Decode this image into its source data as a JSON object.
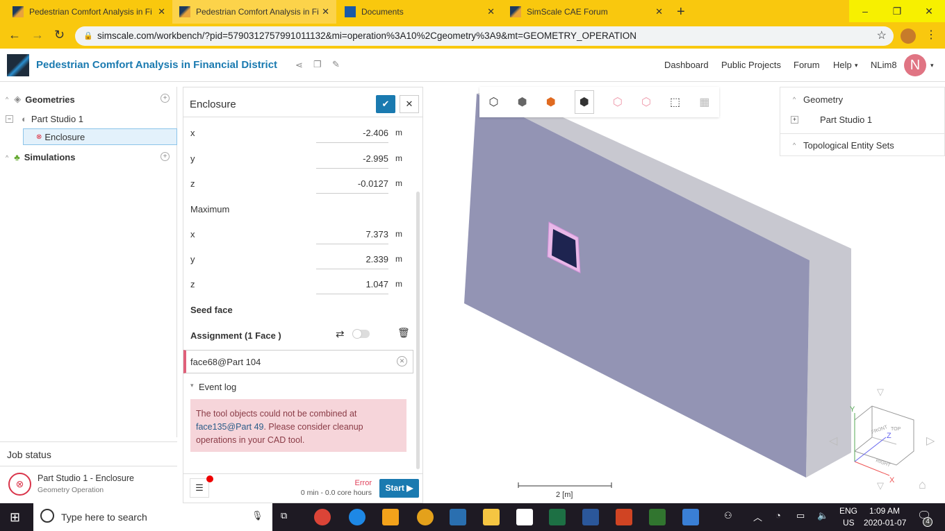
{
  "browser": {
    "tabs": [
      {
        "title": "Pedestrian Comfort Analysis in Fi",
        "active": false
      },
      {
        "title": "Pedestrian Comfort Analysis in Fi",
        "active": true
      },
      {
        "title": "Documents",
        "active": false
      },
      {
        "title": "SimScale CAE Forum",
        "active": false
      }
    ],
    "url": "simscale.com/workbench/?pid=5790312757991011132&mi=operation%3A10%2Cgeometry%3A9&mt=GEOMETRY_OPERATION"
  },
  "header": {
    "title": "Pedestrian Comfort Analysis in Financial District",
    "nav": [
      "Dashboard",
      "Public Projects",
      "Forum",
      "Help"
    ],
    "user": "NLim8",
    "avatar": "N"
  },
  "tree": {
    "geometries": "Geometries",
    "part_studio": "Part Studio 1",
    "enclosure": "Enclosure",
    "simulations": "Simulations"
  },
  "job_status": {
    "title": "Job status",
    "job": "Part Studio 1 - Enclosure",
    "sub": "Geometry Operation"
  },
  "editor": {
    "title": "Enclosure",
    "minimum": [
      {
        "axis": "x",
        "value": "-2.406",
        "unit": "m"
      },
      {
        "axis": "y",
        "value": "-2.995",
        "unit": "m"
      },
      {
        "axis": "z",
        "value": "-0.0127",
        "unit": "m"
      }
    ],
    "maximum_label": "Maximum",
    "maximum": [
      {
        "axis": "x",
        "value": "7.373",
        "unit": "m"
      },
      {
        "axis": "y",
        "value": "2.339",
        "unit": "m"
      },
      {
        "axis": "z",
        "value": "1.047",
        "unit": "m"
      }
    ],
    "seed_face": "Seed face",
    "assignment": "Assignment (1 Face )",
    "face": "face68@Part 104",
    "event_log": "Event log",
    "error_pre": "The tool objects could not be combined at ",
    "error_link": "face135@Part 49",
    "error_post": ". Please consider cleanup operations in your CAD tool.",
    "status": "Error",
    "time": "0 min - 0.0 core hours",
    "start": "Start"
  },
  "right_panel": {
    "geometry": "Geometry",
    "part_studio": "Part Studio 1",
    "topo": "Topological Entity Sets"
  },
  "viewport": {
    "scale": "2 [m]",
    "cube": [
      "FRONT",
      "TOP",
      "RIGHT"
    ],
    "axes": [
      "X",
      "Y",
      "Z"
    ]
  },
  "taskbar": {
    "search": "Type here to search",
    "lang1": "ENG",
    "lang2": "US",
    "time": "1:09 AM",
    "date": "2020-01-07",
    "notif": "4"
  }
}
